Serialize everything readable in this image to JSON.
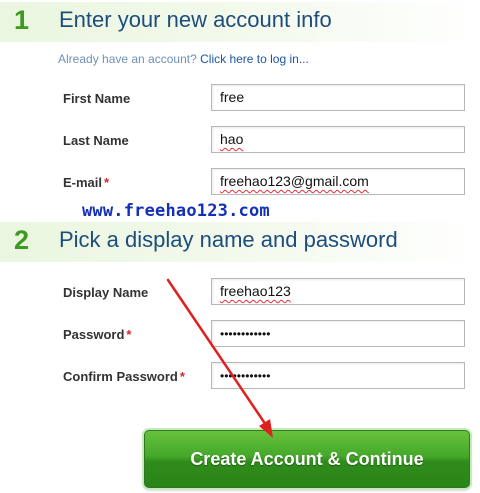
{
  "step1": {
    "number": "1",
    "title": "Enter your new account info"
  },
  "login_prompt": {
    "text": "Already have an account?",
    "link": "Click here to log in..."
  },
  "fields1": {
    "first_name": {
      "label": "First Name",
      "value": "free"
    },
    "last_name": {
      "label": "Last Name",
      "value": "hao"
    },
    "email": {
      "label": "E-mail",
      "required": "*",
      "value": "freehao123@gmail.com"
    }
  },
  "watermark": "www.freehao123.com",
  "step2": {
    "number": "2",
    "title": "Pick a display name and password"
  },
  "fields2": {
    "display_name": {
      "label": "Display Name",
      "value": "freehao123"
    },
    "password": {
      "label": "Password",
      "required": "*",
      "value": "••••••••••••"
    },
    "confirm_password": {
      "label": "Confirm Password",
      "required": "*",
      "value": "••••••••••••"
    }
  },
  "submit_button": "Create Account & Continue",
  "colors": {
    "step_number": "#3a9a22",
    "step_title": "#1d4d7c",
    "link": "#1a55a8",
    "required": "#d22a2a",
    "watermark": "#1430b8",
    "button": "#3a9a22",
    "annotation_arrow": "#e02020"
  }
}
